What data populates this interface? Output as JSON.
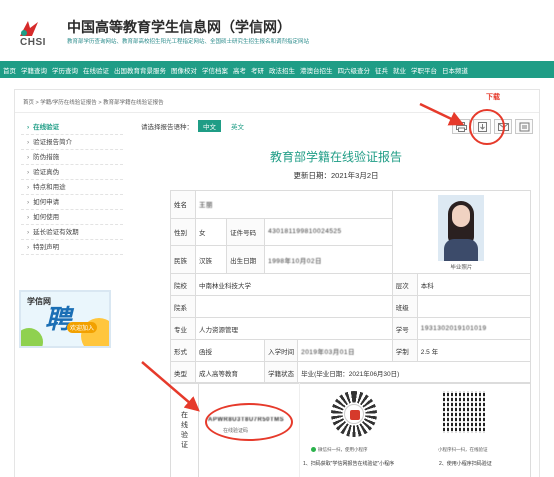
{
  "header": {
    "logo_text": "CHSI",
    "title": "中国高等教育学生信息网（学信网）",
    "subtitle": "教育部学历查询网站、教育部高校招生阳光工程指定网站、全国硕士研究生招生报名和调剂指定网站"
  },
  "nav": {
    "items": [
      "首页",
      "学籍查询",
      "学历查询",
      "在线验证",
      "出国教育背景服务",
      "图像校对",
      "学信档案",
      "高考",
      "考研",
      "政法招生",
      "港澳台招生",
      "四六级查分",
      "征兵",
      "就业",
      "学职平台",
      "日本频道"
    ]
  },
  "breadcrumb": "首页 > 学籍/学历在线验证报告 > 教育部学籍在线验证报告",
  "sidebar": {
    "items": [
      "在线验证",
      "验证报告简介",
      "防伪措施",
      "验证真伪",
      "特点和用途",
      "如何申请",
      "如何使用",
      "延长验证有效期",
      "特别声明"
    ],
    "ad": {
      "brand": "学信网",
      "big": "聘",
      "tag": "欢迎加入"
    }
  },
  "lang": {
    "label": "请选择报告语种：",
    "zh": "中文",
    "en": "英文"
  },
  "download_label": "下载",
  "report": {
    "title": "教育部学籍在线验证报告",
    "update_date": "更新日期：2021年3月2日",
    "rows": {
      "name_lbl": "姓名",
      "name_val": "王丽",
      "gender_lbl": "性别",
      "gender_val": "女",
      "id_lbl": "证件号码",
      "id_val": "430181199810024525",
      "ethnic_lbl": "民族",
      "ethnic_val": "汉族",
      "birth_lbl": "出生日期",
      "birth_val": "1998年10月02日",
      "school_lbl": "院校",
      "school_val": "中南林业科技大学",
      "level_lbl": "层次",
      "level_val": "本科",
      "dept_lbl": "院系",
      "dept_val": "",
      "class_lbl": "班级",
      "class_val": "",
      "major_lbl": "专业",
      "major_val": "人力资源管理",
      "sid_lbl": "学号",
      "sid_val": "1931302019101019",
      "form_lbl": "形式",
      "form_val": "函授",
      "entry_lbl": "入学时间",
      "entry_val": "2019年03月01日",
      "dur_lbl": "学制",
      "dur_val": "2.5 年",
      "type_lbl": "类型",
      "type_val": "成人高等教育",
      "status_lbl": "学籍状态",
      "status_val": "毕业(毕业日期：2021年06月30日)"
    },
    "photo_label": "毕业照片",
    "verify": {
      "label": "在线验证",
      "code": "APWR8U3T8U7R50TMS",
      "code_sub": "在线验证码",
      "qr1_caption": "微信扫一扫，使用小程序",
      "qr2_caption": "小程序扫一扫，在线验证",
      "step1": "1、扫码获取“学信网报告在线验证”小程序",
      "step2": "2、使用小程序扫码验证"
    }
  },
  "colors": {
    "brand_green": "#1f9d86",
    "annotation_red": "#e63a2b"
  }
}
